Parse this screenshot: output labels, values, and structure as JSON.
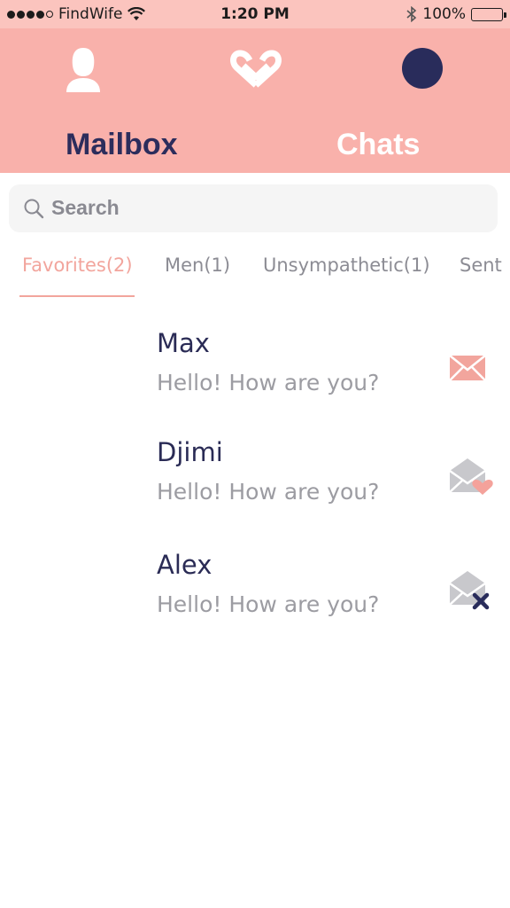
{
  "status_bar": {
    "carrier": "FindWife",
    "time": "1:20 PM",
    "battery": "100%"
  },
  "header": {
    "tabs": [
      {
        "label": "Mailbox",
        "active": true
      },
      {
        "label": "Chats",
        "active": false
      }
    ],
    "icons": [
      "profile-icon",
      "logo-hearts-icon",
      "avatar"
    ]
  },
  "search": {
    "placeholder": "Search"
  },
  "filters": [
    {
      "label": "Favorites(2)",
      "active": true
    },
    {
      "label": "Men(1)",
      "active": false
    },
    {
      "label": "Unsympathetic(1)",
      "active": false
    },
    {
      "label": "Sent",
      "active": false
    }
  ],
  "messages": [
    {
      "name": "Max",
      "text": "Hello! How are you?",
      "icon": "envelope-closed-icon"
    },
    {
      "name": "Djimi",
      "text": "Hello! How are you?",
      "icon": "envelope-open-heart-icon"
    },
    {
      "name": "Alex",
      "text": "Hello! How are you?",
      "icon": "envelope-open-x-icon"
    }
  ],
  "colors": {
    "header_bg": "#f9b1ab",
    "status_bg": "#fbc4be",
    "accent": "#f2a59d",
    "navy": "#292c5b"
  }
}
